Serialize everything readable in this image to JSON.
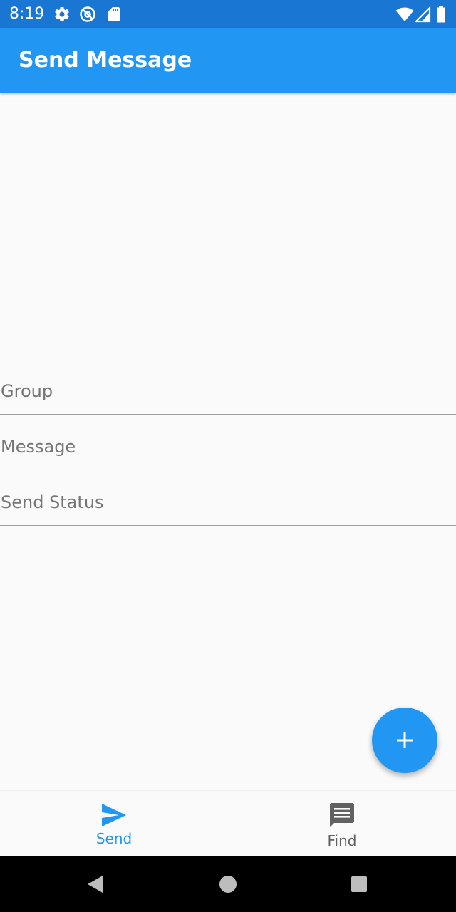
{
  "status_bar": {
    "time": "8:19",
    "icons": [
      "gear-icon",
      "at-sign-icon",
      "sd-card-icon",
      "wifi-icon",
      "signal-icon",
      "battery-icon"
    ]
  },
  "app_bar": {
    "title": "Send Message"
  },
  "form": {
    "group_placeholder": "Group",
    "message_placeholder": "Message",
    "send_status_placeholder": "Send Status"
  },
  "fab": {
    "icon": "plus-icon"
  },
  "bottom_nav": {
    "items": [
      {
        "label": "Send",
        "icon": "send-icon",
        "active": true
      },
      {
        "label": "Find",
        "icon": "chat-icon",
        "active": false
      }
    ]
  },
  "colors": {
    "primary": "#2196f3",
    "status_bar": "#1976d2",
    "active_nav": "#2196f3",
    "inactive_nav": "#616161"
  }
}
